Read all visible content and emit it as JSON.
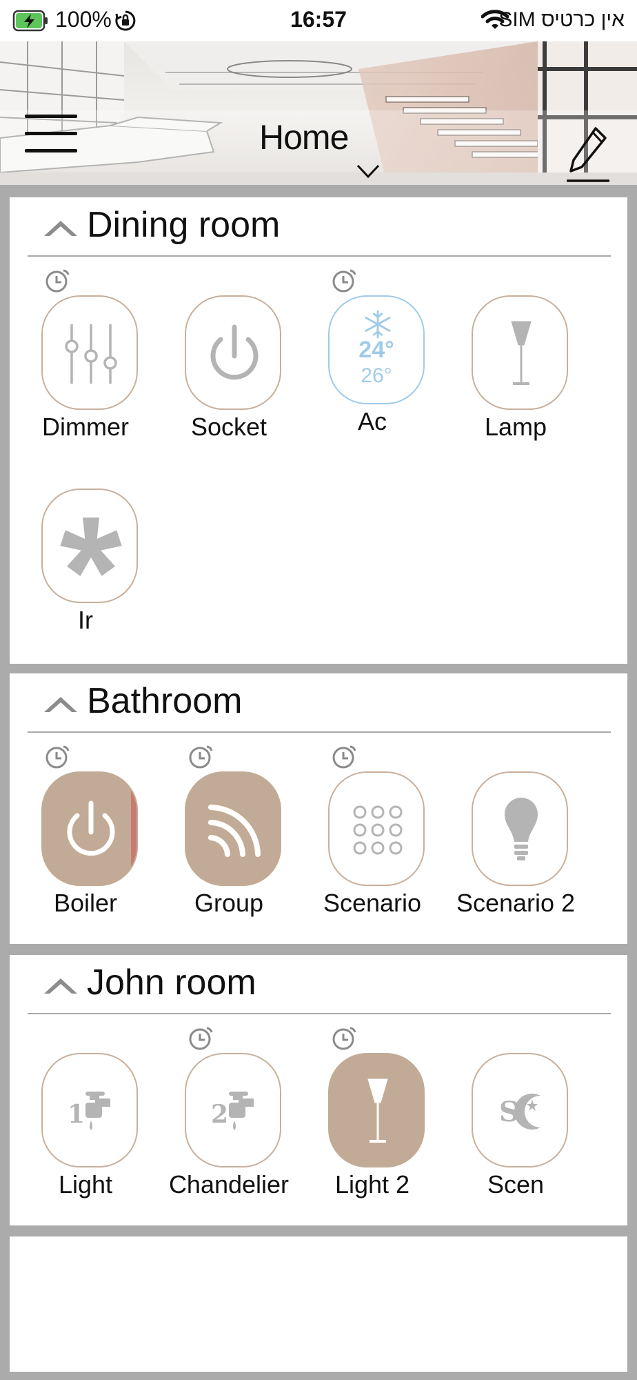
{
  "status_bar": {
    "battery": "100%",
    "time": "16:57",
    "carrier": "אין כרטיס SIM"
  },
  "header": {
    "title": "Home"
  },
  "icons": {
    "menu": "hamburger-menu-icon",
    "home_dropdown": "chevron-down-icon",
    "edit": "pencil-icon",
    "collapse": "chevron-up-icon",
    "timer": "timer-clock-icon"
  },
  "colors": {
    "accent": "#c2ab96",
    "accent_border": "#c8b09c",
    "ac_blue": "#9fcbe8",
    "icon_gray": "#b4b4b4",
    "alert_red": "#c97a72",
    "background": "#ababab"
  },
  "rooms": [
    {
      "name": "Dining room",
      "devices": [
        {
          "label": "Dimmer",
          "icon": "sliders-icon",
          "state": "off",
          "timer": true
        },
        {
          "label": "Socket",
          "icon": "power-icon",
          "state": "off",
          "timer": false
        },
        {
          "label": "Ac",
          "icon": "snowflake-icon",
          "state": "ac",
          "timer": true,
          "temp_set": "24°",
          "temp_current": "26°"
        },
        {
          "label": "Lamp",
          "icon": "floor-lamp-icon",
          "state": "off",
          "timer": false
        },
        {
          "label": "Ir",
          "icon": "fan-icon",
          "state": "off",
          "timer": false
        }
      ]
    },
    {
      "name": "Bathroom",
      "devices": [
        {
          "label": "Boiler",
          "icon": "power-icon",
          "state": "on",
          "timer": true
        },
        {
          "label": "Group",
          "icon": "wireless-signal-icon",
          "state": "on",
          "timer": true
        },
        {
          "label": "Scenario",
          "icon": "dot-grid-icon",
          "state": "off",
          "timer": true
        },
        {
          "label": "Scenario 2",
          "icon": "light-bulb-icon",
          "state": "off",
          "timer": false
        }
      ]
    },
    {
      "name": "John room",
      "devices": [
        {
          "label": "Light",
          "icon": "faucet-1-icon",
          "state": "off",
          "timer": false,
          "badge": "1"
        },
        {
          "label": "Chandelier",
          "icon": "faucet-2-icon",
          "state": "off",
          "timer": true,
          "badge": "2"
        },
        {
          "label": "Light 2",
          "icon": "floor-lamp-icon",
          "state": "on",
          "timer": true
        },
        {
          "label": "Scen",
          "icon": "sun-moon-icon",
          "state": "off",
          "timer": false
        }
      ]
    }
  ]
}
